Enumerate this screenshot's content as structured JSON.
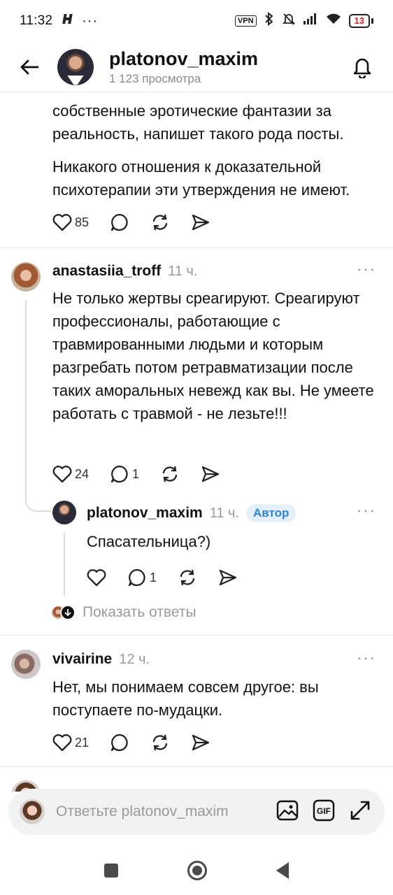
{
  "status": {
    "time": "11:32",
    "vpn": "VPN",
    "battery": "13"
  },
  "header": {
    "title": "platonov_maxim",
    "subtitle": "1 123 просмотра"
  },
  "top_post": {
    "text_line1": "собственные эротические фантазии за реальность, напишет такого рода посты.",
    "text_line2": "Никакого отношения к доказательной психотерапии эти утверждения не имеют.",
    "likes": "85"
  },
  "comments": [
    {
      "username": "anastasiia_troff",
      "time": "11 ч.",
      "text": "Не только жертвы среагируют. Среагируют профессионалы, работающие с травмированными людьми и которым разгребать потом ретравматизации после таких аморальных невежд как вы. Не умеете работать с травмой - не лезьте!!!",
      "likes": "24",
      "replies": "1"
    },
    {
      "username": "platonov_maxim",
      "time": "11 ч.",
      "badge": "Автор",
      "text": "Спасательница?)",
      "replies": "1"
    },
    {
      "username": "vivairine",
      "time": "12 ч.",
      "text": "Нет, мы понимаем совсем другое: вы поступаете по-мудацки.",
      "likes": "21"
    }
  ],
  "show_replies": "Показать ответы",
  "more_glyph": "···",
  "reply_bar": {
    "placeholder": "Ответьте platonov_maxim"
  }
}
